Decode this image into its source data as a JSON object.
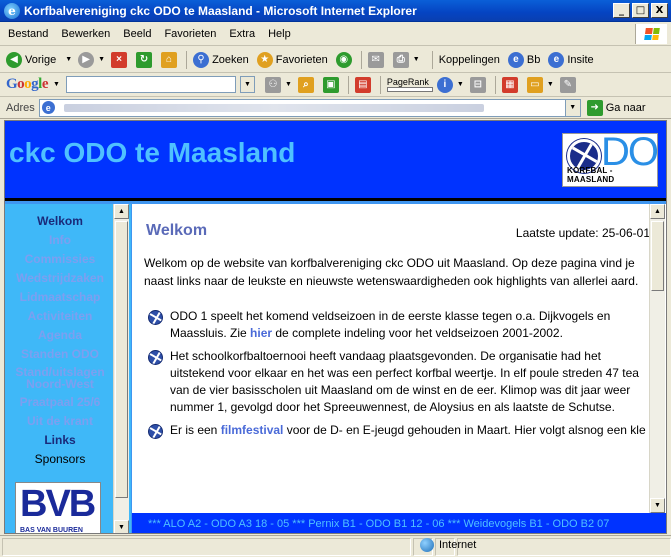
{
  "window": {
    "title": "Korfbalvereniging ckc ODO te Maasland - Microsoft Internet Explorer",
    "buttons": {
      "minimize": "_",
      "maximize": "□",
      "close": "X"
    }
  },
  "menu": [
    "Bestand",
    "Bewerken",
    "Beeld",
    "Favorieten",
    "Extra",
    "Help"
  ],
  "toolbar": {
    "back": "Vorige",
    "search": "Zoeken",
    "favorites": "Favorieten",
    "links": "Koppelingen",
    "bb": "Bb",
    "insite": "Insite"
  },
  "google_bar": {
    "logo": "Google",
    "search_value": "",
    "pagerank_label": "PageRank"
  },
  "address": {
    "label": "Adres",
    "go": "Ga naar"
  },
  "site": {
    "title": "ckc ODO te Maasland",
    "logo_letters": "DO",
    "logo_sub": "KORFBAL - MAASLAND"
  },
  "nav": {
    "items": [
      {
        "label": "Welkom",
        "style": "active"
      },
      {
        "label": "Info",
        "style": ""
      },
      {
        "label": "Commissies",
        "style": ""
      },
      {
        "label": "Wedstrijdzaken",
        "style": ""
      },
      {
        "label": "Lidmaatschap",
        "style": ""
      },
      {
        "label": "Activiteiten",
        "style": ""
      },
      {
        "label": "Agenda",
        "style": ""
      },
      {
        "label": "Standen ODO",
        "style": ""
      },
      {
        "label": "Stand/uitslagen Noord-West",
        "style": "two"
      },
      {
        "label": "Praatpaal 25/6",
        "style": ""
      },
      {
        "label": "Uit de krant",
        "style": ""
      },
      {
        "label": "Links",
        "style": "dark"
      },
      {
        "label": "Sponsors",
        "style": "norm"
      }
    ],
    "sponsor_logo": "BVB",
    "sponsor_sub": "BAS VAN BUUREN"
  },
  "main": {
    "heading": "Welkom",
    "last_update": "Laatste update: 25-06-01",
    "intro": "Welkom op de website van korfbalvereniging ckc ODO uit Maasland. Op deze pagina vind je naast links naar de leukste en nieuwste wetenswaardigheden ook highlights van allerlei aard.",
    "news": [
      {
        "lines": [
          {
            "parts": [
              {
                "t": "ODO 1 speelt het komend veldseizoen in de eerste klasse tegen o.a. Dijkvogels en"
              }
            ]
          },
          {
            "parts": [
              {
                "t": "Maassluis. Zie "
              },
              {
                "t": "hier",
                "link": true
              },
              {
                "t": " de complete indeling voor het veldseizoen 2001-2002."
              }
            ]
          }
        ]
      },
      {
        "lines": [
          {
            "parts": [
              {
                "t": "Het schoolkorfbaltoernooi heeft vandaag plaatsgevonden. De organisatie had het"
              }
            ]
          },
          {
            "parts": [
              {
                "t": "uitstekend voor elkaar en het was een perfect korfbal weertje. In elf poule streden 47 tea"
              }
            ]
          },
          {
            "parts": [
              {
                "t": "van de vier basisscholen uit Maasland om de winst en de eer. Klimop was dit jaar weer"
              }
            ]
          },
          {
            "parts": [
              {
                "t": "nummer 1, gevolgd door het Spreeuwennest, de Aloysius en als laatste de Schutse."
              }
            ]
          }
        ]
      },
      {
        "lines": [
          {
            "parts": [
              {
                "t": "Er is een "
              },
              {
                "t": "filmfestival",
                "link": true
              },
              {
                "t": " voor de D- en E-jeugd gehouden in Maart. Hier volgt alsnog een kle"
              }
            ]
          }
        ]
      }
    ]
  },
  "ticker": "*** ALO A2 - ODO A3 18 - 05 *** Pernix B1 - ODO B1 12 - 06 *** Weidevogels B1 - ODO B2 07",
  "status": {
    "zone": "Internet"
  }
}
